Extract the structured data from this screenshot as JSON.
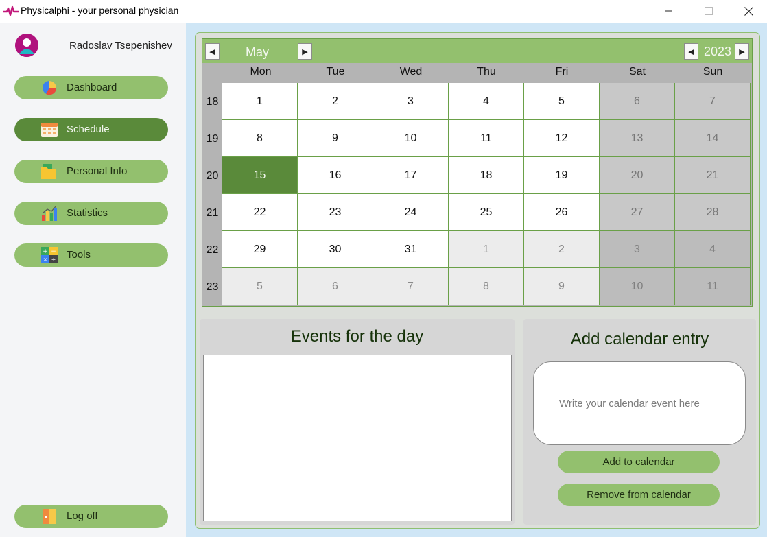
{
  "window": {
    "title": "Physicalphi - your personal physician",
    "minimize_icon": "minimize-icon",
    "maximize_icon": "maximize-icon",
    "close_icon": "close-icon"
  },
  "sidebar": {
    "user_name": "Radoslav Tsepenishev",
    "items": [
      {
        "label": "Dashboard",
        "icon": "pie-chart-icon"
      },
      {
        "label": "Schedule",
        "icon": "calendar-icon",
        "active": true
      },
      {
        "label": "Personal Info",
        "icon": "folder-icon"
      },
      {
        "label": "Statistics",
        "icon": "bar-chart-icon"
      },
      {
        "label": "Tools",
        "icon": "calculator-icon"
      }
    ],
    "logoff": {
      "label": "Log off",
      "icon": "door-icon"
    }
  },
  "calendar": {
    "month": "May",
    "year": "2023",
    "prev_month": "◀",
    "next_month": "▶",
    "prev_year": "◀",
    "next_year": "▶",
    "weekdays": [
      "Mon",
      "Tue",
      "Wed",
      "Thu",
      "Fri",
      "Sat",
      "Sun"
    ],
    "week_numbers": [
      "18",
      "19",
      "20",
      "21",
      "22",
      "23"
    ],
    "weeks": [
      [
        "1",
        "2",
        "3",
        "4",
        "5",
        "6",
        "7"
      ],
      [
        "8",
        "9",
        "10",
        "11",
        "12",
        "13",
        "14"
      ],
      [
        "15",
        "16",
        "17",
        "18",
        "19",
        "20",
        "21"
      ],
      [
        "22",
        "23",
        "24",
        "25",
        "26",
        "27",
        "28"
      ],
      [
        "29",
        "30",
        "31",
        "1",
        "2",
        "3",
        "4"
      ],
      [
        "5",
        "6",
        "7",
        "8",
        "9",
        "10",
        "11"
      ]
    ],
    "selected_day": "15"
  },
  "events": {
    "title": "Events for the day"
  },
  "add_entry": {
    "title": "Add calendar entry",
    "placeholder": "Write your calendar event here",
    "add_button": "Add to calendar",
    "remove_button": "Remove from calendar"
  },
  "colors": {
    "accent": "#93c06e",
    "accent_dark": "#5a8a3a",
    "sidebar_bg": "#f4f5f7",
    "main_bg": "#cfe6f6"
  }
}
